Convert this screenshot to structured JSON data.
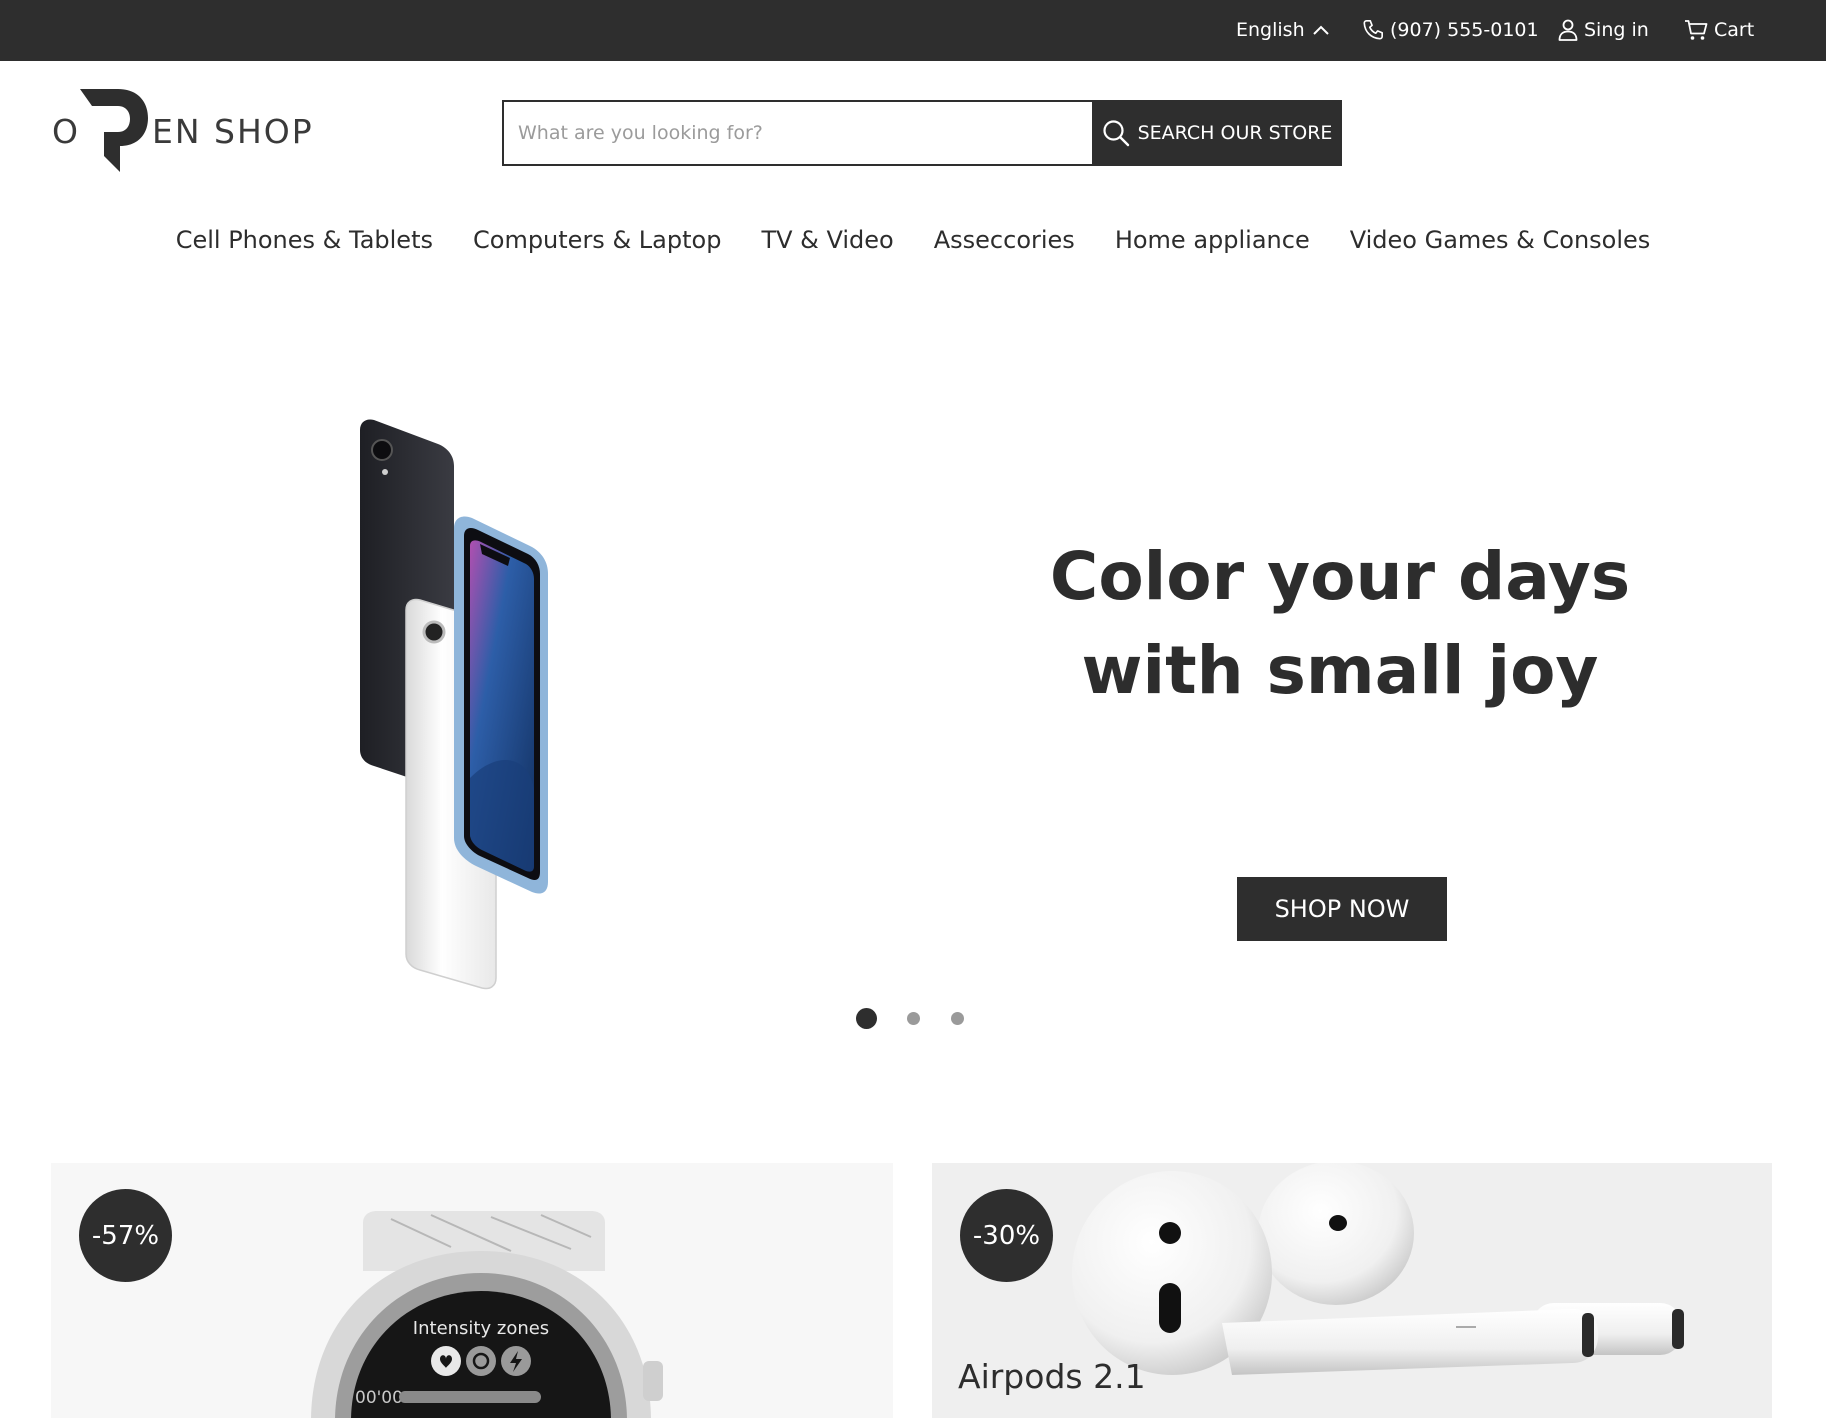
{
  "topbar": {
    "language": "English",
    "phone": "(907) 555-0101",
    "signin": "Sing in",
    "cart": "Cart"
  },
  "logo": {
    "o": "O",
    "rest": "EN SHOP"
  },
  "search": {
    "placeholder": "What are you looking for?",
    "button": "SEARCH OUR STORE"
  },
  "nav": {
    "items": [
      "Cell Phones & Tablets",
      "Computers & Laptop",
      "TV & Video",
      "Asseccories",
      "Home appliance",
      "Video Games & Consoles"
    ]
  },
  "hero": {
    "title": "Color your days with small joy",
    "button": "SHOP NOW",
    "slide_count": 3,
    "active_slide": 1
  },
  "promos": [
    {
      "badge": "-57%",
      "title": "",
      "watch_text": "Intensity zones",
      "watch_time": "00'00"
    },
    {
      "badge": "-30%",
      "title": "Airpods 2.1"
    }
  ],
  "colors": {
    "dark": "#2e2e2e",
    "muted": "#9a9a9a"
  }
}
